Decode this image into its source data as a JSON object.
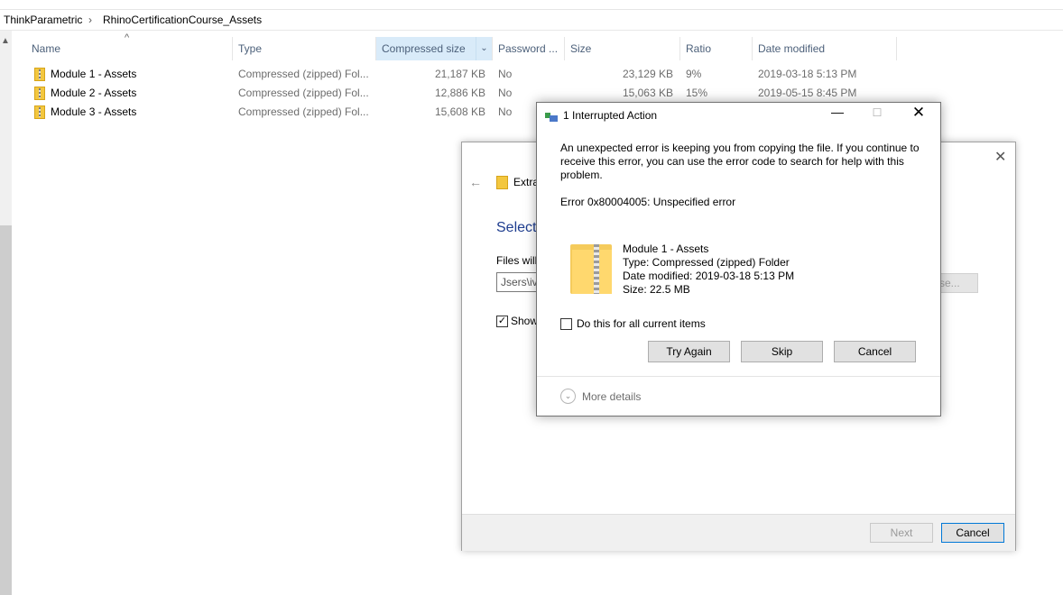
{
  "breadcrumb": {
    "items": [
      "ThinkParametric",
      "RhinoCertificationCourse_Assets"
    ],
    "separator": "›"
  },
  "columns": {
    "name": "Name",
    "type": "Type",
    "compressed_size": "Compressed size",
    "password": "Password ...",
    "size": "Size",
    "ratio": "Ratio",
    "date_modified": "Date modified"
  },
  "files": [
    {
      "name": "Module 1 - Assets",
      "type": "Compressed (zipped) Fol...",
      "compressed": "21,187 KB",
      "password": "No",
      "size": "23,129 KB",
      "ratio": "9%",
      "date": "2019-03-18 5:13 PM"
    },
    {
      "name": "Module 2 - Assets",
      "type": "Compressed (zipped) Fol...",
      "compressed": "12,886 KB",
      "password": "No",
      "size": "15,063 KB",
      "ratio": "15%",
      "date": "2019-05-15 8:45 PM"
    },
    {
      "name": "Module 3 - Assets",
      "type": "Compressed (zipped) Fol...",
      "compressed": "15,608 KB",
      "password": "No",
      "size": "",
      "ratio": "",
      "date": ""
    }
  ],
  "wizard": {
    "title": "Extra",
    "heading": "Select",
    "files_label": "Files will",
    "path_value": "Jsers\\iv",
    "browse_label": "se...",
    "show_label": "Show",
    "next_label": "Next",
    "cancel_label": "Cancel"
  },
  "dialog": {
    "title": "1 Interrupted Action",
    "message": "An unexpected error is keeping you from copying the file. If you continue to receive this error, you can use the error code to search for help with this problem.",
    "error": "Error 0x80004005: Unspecified error",
    "file_name": "Module 1 - Assets",
    "file_type": "Type: Compressed (zipped) Folder",
    "file_date": "Date modified: 2019-03-18 5:13 PM",
    "file_size": "Size: 22.5 MB",
    "checkbox_label": "Do this for all current items",
    "try_again": "Try Again",
    "skip": "Skip",
    "cancel": "Cancel",
    "more_details": "More details"
  }
}
